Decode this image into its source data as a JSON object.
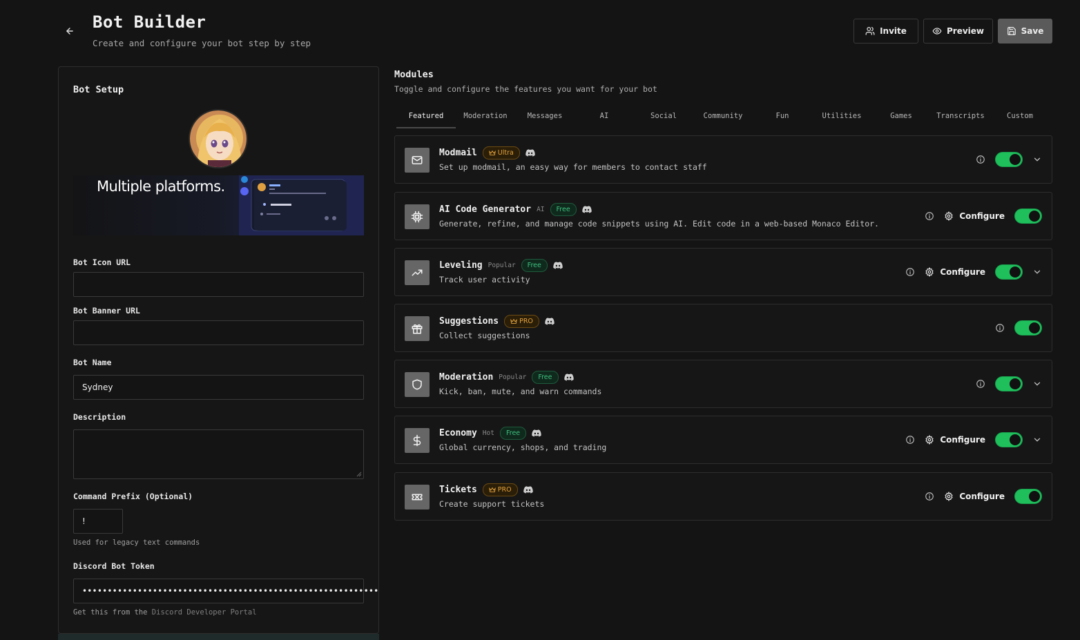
{
  "header": {
    "title": "Bot Builder",
    "subtitle": "Create and configure your bot step by step",
    "invite_label": "Invite",
    "preview_label": "Preview",
    "save_label": "Save"
  },
  "setup": {
    "title": "Bot Setup",
    "banner_text": "Multiple platforms.",
    "bot_icon_label": "Bot Icon URL",
    "bot_icon_value": "",
    "bot_banner_label": "Bot Banner URL",
    "bot_banner_value": "",
    "bot_name_label": "Bot Name",
    "bot_name_value": "Sydney",
    "description_label": "Description",
    "description_value": "",
    "prefix_label": "Command Prefix (Optional)",
    "prefix_value": "!",
    "prefix_hint": "Used for legacy text commands",
    "token_label": "Discord Bot Token",
    "token_value": "•••••••••••••••••••••••••••••••••••••••••••••••••••••••••••",
    "token_hint_prefix": "Get this from the",
    "token_hint_link": "Discord Developer Portal"
  },
  "modules": {
    "title": "Modules",
    "subtitle": "Toggle and configure the features you want for your bot",
    "tabs": [
      "Featured",
      "Moderation",
      "Messages",
      "AI",
      "Social",
      "Community",
      "Fun",
      "Utilities",
      "Games",
      "Transcripts",
      "Custom"
    ],
    "active_tab": "Featured",
    "configure_label": "Configure",
    "items": [
      {
        "name": "Modmail",
        "tag": "",
        "badge": "Ultra",
        "icon": "mail-icon",
        "desc": "Set up modmail, an easy way for members to contact staff",
        "configure": false,
        "enabled": true,
        "expand": true
      },
      {
        "name": "AI Code Generator",
        "tag": "AI",
        "badge": "Free",
        "icon": "cpu-icon",
        "desc": "Generate, refine, and manage code snippets using AI. Edit code in a web-based Monaco Editor.",
        "configure": true,
        "enabled": true,
        "expand": false
      },
      {
        "name": "Leveling",
        "tag": "Popular",
        "badge": "Free",
        "icon": "trending-up-icon",
        "desc": "Track user activity",
        "configure": true,
        "enabled": true,
        "expand": true
      },
      {
        "name": "Suggestions",
        "tag": "",
        "badge": "PRO",
        "icon": "gift-icon",
        "desc": "Collect suggestions",
        "configure": false,
        "enabled": true,
        "expand": false
      },
      {
        "name": "Moderation",
        "tag": "Popular",
        "badge": "Free",
        "icon": "shield-icon",
        "desc": "Kick, ban, mute, and warn commands",
        "configure": false,
        "enabled": true,
        "expand": true
      },
      {
        "name": "Economy",
        "tag": "Hot",
        "badge": "Free",
        "icon": "dollar-icon",
        "desc": "Global currency, shops, and trading",
        "configure": true,
        "enabled": true,
        "expand": true
      },
      {
        "name": "Tickets",
        "tag": "",
        "badge": "PRO",
        "icon": "ticket-icon",
        "desc": "Create support tickets",
        "configure": true,
        "enabled": true,
        "expand": false
      }
    ]
  },
  "colors": {
    "background": "#141414",
    "toggle_on": "#1fbf5c",
    "badge_pro": "#e6a33c",
    "badge_free": "#3fbf7f"
  }
}
